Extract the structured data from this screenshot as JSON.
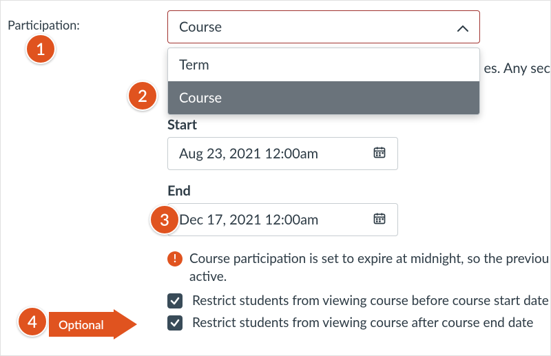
{
  "participation": {
    "label": "Participation:",
    "selected": "Course",
    "options": [
      "Term",
      "Course"
    ],
    "trailing_text": "es. Any sec"
  },
  "dates": {
    "start_label": "Start",
    "start_value": "Aug 23, 2021 12:00am",
    "end_label": "End",
    "end_value": "Dec 17, 2021 12:00am"
  },
  "warning": {
    "icon": "!",
    "text": "Course participation is set to expire at midnight, so the previou active."
  },
  "restrictions": {
    "before": {
      "label": "Restrict students from viewing course before course start date",
      "checked": true
    },
    "after": {
      "label": "Restrict students from viewing course after course end date",
      "checked": true
    }
  },
  "annotations": {
    "badge1": "1",
    "badge2": "2",
    "badge3": "3",
    "badge4": "4",
    "optional_label": "Optional"
  },
  "colors": {
    "accent": "#e0531f",
    "select_border": "#a0322f",
    "checkbox_bg": "#394b58",
    "dropdown_hover": "#6a737b"
  }
}
